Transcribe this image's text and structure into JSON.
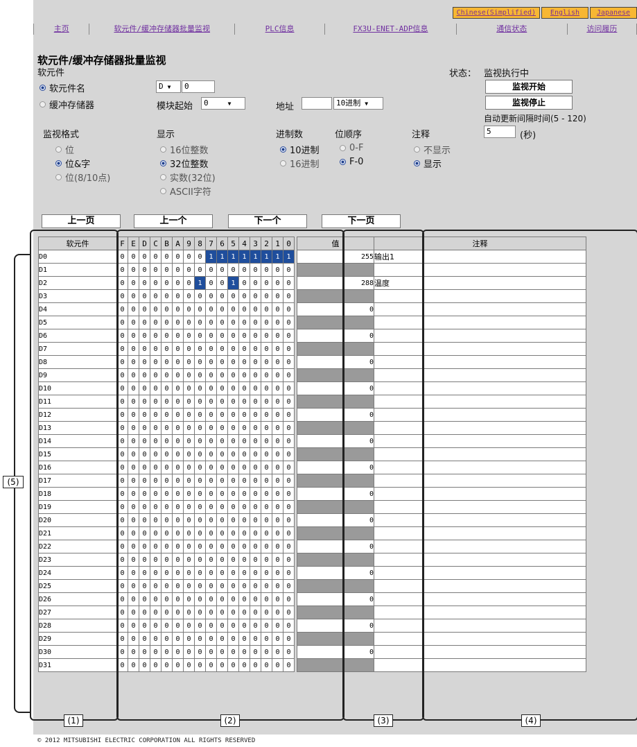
{
  "languages": [
    "Chinese(Simplified)",
    "English",
    "Japanese"
  ],
  "nav": [
    "主页",
    "软元件/缓冲存储器批量监视",
    "PLC信息",
    "FX3U-ENET-ADP信息",
    "通信状态",
    "访问履历"
  ],
  "page_title": "软元件/缓冲存储器批量监视",
  "section_label": "软元件",
  "device_radio": {
    "device_name": "软元件名",
    "buffer_memory": "缓冲存储器"
  },
  "device_type": "D",
  "device_no": "0",
  "module_start_label": "模块起始",
  "module_start_value": "0",
  "address_label": "地址",
  "address_value": "",
  "address_base": "10进制",
  "status_label": "状态：",
  "status_value": "监视执行中",
  "start_monitor": "监视开始",
  "stop_monitor": "监视停止",
  "interval_label": "自动更新间隔时间(5 - 120)",
  "interval_value": "5",
  "interval_unit": "(秒)",
  "monitor_format": {
    "label": "监视格式",
    "bit": "位",
    "bit_word": "位&字",
    "bit_8_10": "位(8/10点)"
  },
  "display": {
    "label": "显示",
    "int16": "16位整数",
    "int32": "32位整数",
    "real": "实数(32位)",
    "ascii": "ASCII字符"
  },
  "radix": {
    "label": "进制数",
    "dec": "10进制",
    "hex": "16进制"
  },
  "bit_order": {
    "label": "位顺序",
    "a": "0-F",
    "b": "F-0"
  },
  "comment_opt": {
    "label": "注释",
    "hide": "不显示",
    "show": "显示"
  },
  "paging": {
    "prev_page": "上一页",
    "prev": "上一个",
    "next": "下一个",
    "next_page": "下一页"
  },
  "table_headers": {
    "device": "软元件",
    "value": "值",
    "comment": "注释"
  },
  "bit_headers": [
    "F",
    "E",
    "D",
    "C",
    "B",
    "A",
    "9",
    "8",
    "7",
    "6",
    "5",
    "4",
    "3",
    "2",
    "1",
    "0"
  ],
  "rows": [
    {
      "dev": "D0",
      "bits": "0000000011111111",
      "value": "255",
      "comment": "输出1"
    },
    {
      "dev": "D1",
      "bits": "0000000000000000",
      "value": "",
      "comment": ""
    },
    {
      "dev": "D2",
      "bits": "0000000100100000",
      "value": "288",
      "comment": "温度"
    },
    {
      "dev": "D3",
      "bits": "0000000000000000",
      "value": "",
      "comment": ""
    },
    {
      "dev": "D4",
      "bits": "0000000000000000",
      "value": "0",
      "comment": ""
    },
    {
      "dev": "D5",
      "bits": "0000000000000000",
      "value": "",
      "comment": ""
    },
    {
      "dev": "D6",
      "bits": "0000000000000000",
      "value": "0",
      "comment": ""
    },
    {
      "dev": "D7",
      "bits": "0000000000000000",
      "value": "",
      "comment": ""
    },
    {
      "dev": "D8",
      "bits": "0000000000000000",
      "value": "0",
      "comment": ""
    },
    {
      "dev": "D9",
      "bits": "0000000000000000",
      "value": "",
      "comment": ""
    },
    {
      "dev": "D10",
      "bits": "0000000000000000",
      "value": "0",
      "comment": ""
    },
    {
      "dev": "D11",
      "bits": "0000000000000000",
      "value": "",
      "comment": ""
    },
    {
      "dev": "D12",
      "bits": "0000000000000000",
      "value": "0",
      "comment": ""
    },
    {
      "dev": "D13",
      "bits": "0000000000000000",
      "value": "",
      "comment": ""
    },
    {
      "dev": "D14",
      "bits": "0000000000000000",
      "value": "0",
      "comment": ""
    },
    {
      "dev": "D15",
      "bits": "0000000000000000",
      "value": "",
      "comment": ""
    },
    {
      "dev": "D16",
      "bits": "0000000000000000",
      "value": "0",
      "comment": ""
    },
    {
      "dev": "D17",
      "bits": "0000000000000000",
      "value": "",
      "comment": ""
    },
    {
      "dev": "D18",
      "bits": "0000000000000000",
      "value": "0",
      "comment": ""
    },
    {
      "dev": "D19",
      "bits": "0000000000000000",
      "value": "",
      "comment": ""
    },
    {
      "dev": "D20",
      "bits": "0000000000000000",
      "value": "0",
      "comment": ""
    },
    {
      "dev": "D21",
      "bits": "0000000000000000",
      "value": "",
      "comment": ""
    },
    {
      "dev": "D22",
      "bits": "0000000000000000",
      "value": "0",
      "comment": ""
    },
    {
      "dev": "D23",
      "bits": "0000000000000000",
      "value": "",
      "comment": ""
    },
    {
      "dev": "D24",
      "bits": "0000000000000000",
      "value": "0",
      "comment": ""
    },
    {
      "dev": "D25",
      "bits": "0000000000000000",
      "value": "",
      "comment": ""
    },
    {
      "dev": "D26",
      "bits": "0000000000000000",
      "value": "0",
      "comment": ""
    },
    {
      "dev": "D27",
      "bits": "0000000000000000",
      "value": "",
      "comment": ""
    },
    {
      "dev": "D28",
      "bits": "0000000000000000",
      "value": "0",
      "comment": ""
    },
    {
      "dev": "D29",
      "bits": "0000000000000000",
      "value": "",
      "comment": ""
    },
    {
      "dev": "D30",
      "bits": "0000000000000000",
      "value": "0",
      "comment": ""
    },
    {
      "dev": "D31",
      "bits": "0000000000000000",
      "value": "",
      "comment": ""
    }
  ],
  "callouts": [
    "(1)",
    "(2)",
    "(3)",
    "(4)",
    "(5)"
  ],
  "footer": "© 2012 MITSUBISHI ELECTRIC CORPORATION ALL RIGHTS RESERVED",
  "colors": {
    "panel": "#d6d6d6",
    "bit_on": "#1f4e9c",
    "lang_bg": "#f7b733",
    "nav_link": "#7030a0",
    "value_empty": "#9a9a9a"
  }
}
